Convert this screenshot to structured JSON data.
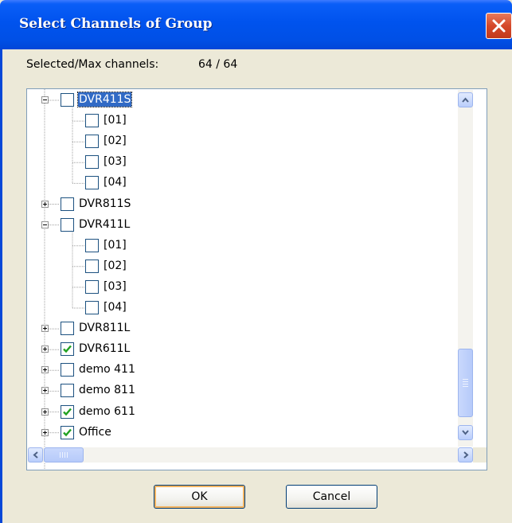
{
  "dialog": {
    "title": "Select Channels of Group"
  },
  "info": {
    "label": "Selected/Max channels:",
    "value": "64 / 64"
  },
  "tree": {
    "nodes": [
      {
        "label": "DVR411S",
        "level": 0,
        "expander": "minus",
        "checked": false,
        "selected": true
      },
      {
        "label": "[01]",
        "level": 1,
        "checked": false
      },
      {
        "label": "[02]",
        "level": 1,
        "checked": false
      },
      {
        "label": "[03]",
        "level": 1,
        "checked": false
      },
      {
        "label": "[04]",
        "level": 1,
        "checked": false
      },
      {
        "label": "DVR811S",
        "level": 0,
        "expander": "plus",
        "checked": false
      },
      {
        "label": "DVR411L",
        "level": 0,
        "expander": "minus",
        "checked": false
      },
      {
        "label": "[01]",
        "level": 1,
        "checked": false
      },
      {
        "label": "[02]",
        "level": 1,
        "checked": false
      },
      {
        "label": "[03]",
        "level": 1,
        "checked": false
      },
      {
        "label": "[04]",
        "level": 1,
        "checked": false
      },
      {
        "label": "DVR811L",
        "level": 0,
        "expander": "plus",
        "checked": false
      },
      {
        "label": "DVR611L",
        "level": 0,
        "expander": "plus",
        "checked": true
      },
      {
        "label": "demo 411",
        "level": 0,
        "expander": "plus",
        "checked": false
      },
      {
        "label": "demo 811",
        "level": 0,
        "expander": "plus",
        "checked": false
      },
      {
        "label": "demo 611",
        "level": 0,
        "expander": "plus",
        "checked": true
      },
      {
        "label": "Office",
        "level": 0,
        "expander": "plus",
        "checked": true
      }
    ]
  },
  "buttons": {
    "ok_label": "OK",
    "cancel_label": "Cancel"
  },
  "colors": {
    "title_bar": "#0053ee",
    "selection": "#316ac5",
    "checkmark": "#21a121",
    "close_button": "#d5482a"
  }
}
